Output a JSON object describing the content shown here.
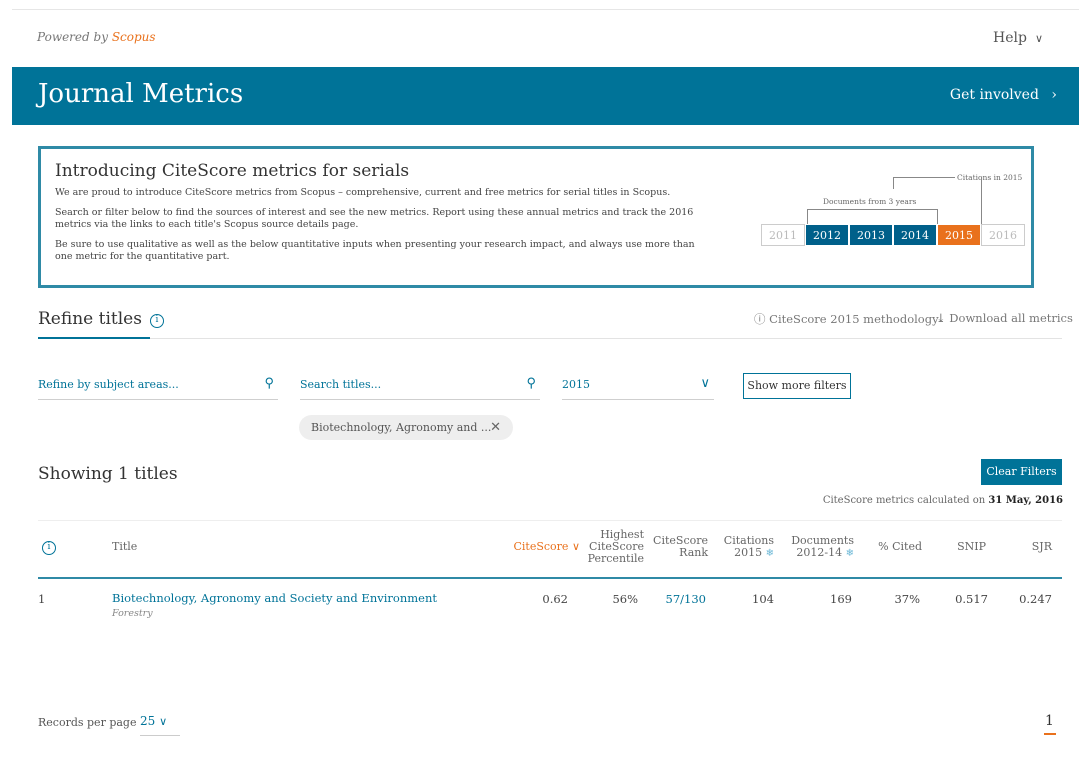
{
  "header": {
    "powered_prefix": "Powered by",
    "powered_brand": "Scopus",
    "help_label": "Help"
  },
  "banner": {
    "title": "Journal Metrics",
    "get_involved": "Get involved"
  },
  "intro": {
    "heading": "Introducing CiteScore metrics for serials",
    "p1": "We are proud to introduce CiteScore metrics from Scopus – comprehensive, current and free metrics for serial titles in Scopus.",
    "p2": "Search or filter below to find the sources of interest and see the new metrics. Report using these annual metrics and track the 2016 metrics via the links to each title's Scopus source details page.",
    "p3": "Be sure to use qualitative as well as the below quantitative inputs when presenting your research impact, and always use more than one metric for the quantitative part.",
    "diagram": {
      "citations_label": "Citations in 2015",
      "documents_label": "Documents from 3 years",
      "years": [
        "2011",
        "2012",
        "2013",
        "2014",
        "2015",
        "2016"
      ]
    }
  },
  "refine": {
    "title": "Refine titles",
    "methodology": "CiteScore 2015 methodology",
    "download": "Download all metrics",
    "subject_placeholder": "Refine by subject areas...",
    "search_placeholder": "Search titles...",
    "year_value": "2015",
    "show_more": "Show more filters",
    "chip_label": "Biotechnology, Agronomy and ..."
  },
  "results": {
    "showing": "Showing 1 titles",
    "clear_filters": "Clear Filters",
    "calc_prefix": "CiteScore metrics calculated on",
    "calc_date": "31 May, 2016"
  },
  "table": {
    "headers": {
      "title": "Title",
      "citescore": "CiteScore",
      "percentile_1": "Highest",
      "percentile_2": "CiteScore",
      "percentile_3": "Percentile",
      "rank_1": "CiteScore",
      "rank_2": "Rank",
      "citations_1": "Citations",
      "citations_2": "2015",
      "documents_1": "Documents",
      "documents_2": "2012-14",
      "cited": "% Cited",
      "snip": "SNIP",
      "sjr": "SJR"
    },
    "rows": [
      {
        "index": "1",
        "title": "Biotechnology, Agronomy and Society and Environment",
        "subject": "Forestry",
        "citescore": "0.62",
        "percentile": "56%",
        "rank": "57/130",
        "citations": "104",
        "documents": "169",
        "cited": "37%",
        "snip": "0.517",
        "sjr": "0.247"
      }
    ]
  },
  "footer": {
    "records_label": "Records per page",
    "records_value": "25",
    "page": "1"
  },
  "colors": {
    "primary": "#007398",
    "accent": "#e9711c"
  }
}
